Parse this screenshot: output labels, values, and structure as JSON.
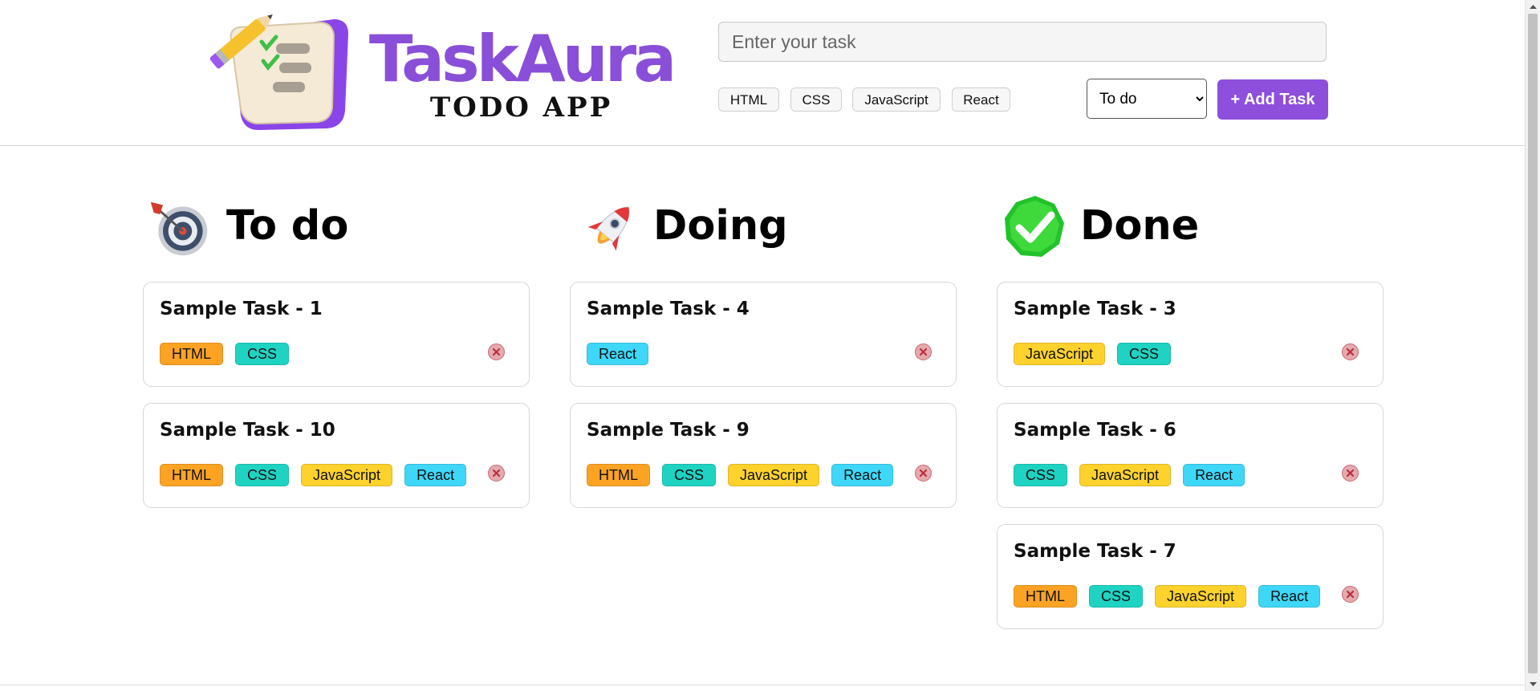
{
  "app": {
    "brand_name": "TaskAura",
    "brand_subtitle": "TODO APP"
  },
  "form": {
    "task_placeholder": "Enter your task",
    "task_value": "",
    "tags": [
      "HTML",
      "CSS",
      "JavaScript",
      "React"
    ],
    "status_selected": "To do",
    "add_button_label": "+ Add Task"
  },
  "tag_colors": {
    "HTML": "#fca324",
    "CSS": "#1fd3c2",
    "JavaScript": "#fdd22d",
    "React": "#3fd7f8"
  },
  "columns": [
    {
      "title": "To do",
      "icon": "target-dart-icon",
      "tasks": [
        {
          "title": "Sample Task - 1",
          "tags": [
            "HTML",
            "CSS"
          ]
        },
        {
          "title": "Sample Task - 10",
          "tags": [
            "HTML",
            "CSS",
            "JavaScript",
            "React"
          ]
        }
      ]
    },
    {
      "title": "Doing",
      "icon": "rocket-icon",
      "tasks": [
        {
          "title": "Sample Task - 4",
          "tags": [
            "React"
          ]
        },
        {
          "title": "Sample Task - 9",
          "tags": [
            "HTML",
            "CSS",
            "JavaScript",
            "React"
          ]
        }
      ]
    },
    {
      "title": "Done",
      "icon": "check-mark-icon",
      "tasks": [
        {
          "title": "Sample Task - 3",
          "tags": [
            "JavaScript",
            "CSS"
          ]
        },
        {
          "title": "Sample Task - 6",
          "tags": [
            "CSS",
            "JavaScript",
            "React"
          ]
        },
        {
          "title": "Sample Task - 7",
          "tags": [
            "HTML",
            "CSS",
            "JavaScript",
            "React"
          ]
        }
      ]
    }
  ]
}
